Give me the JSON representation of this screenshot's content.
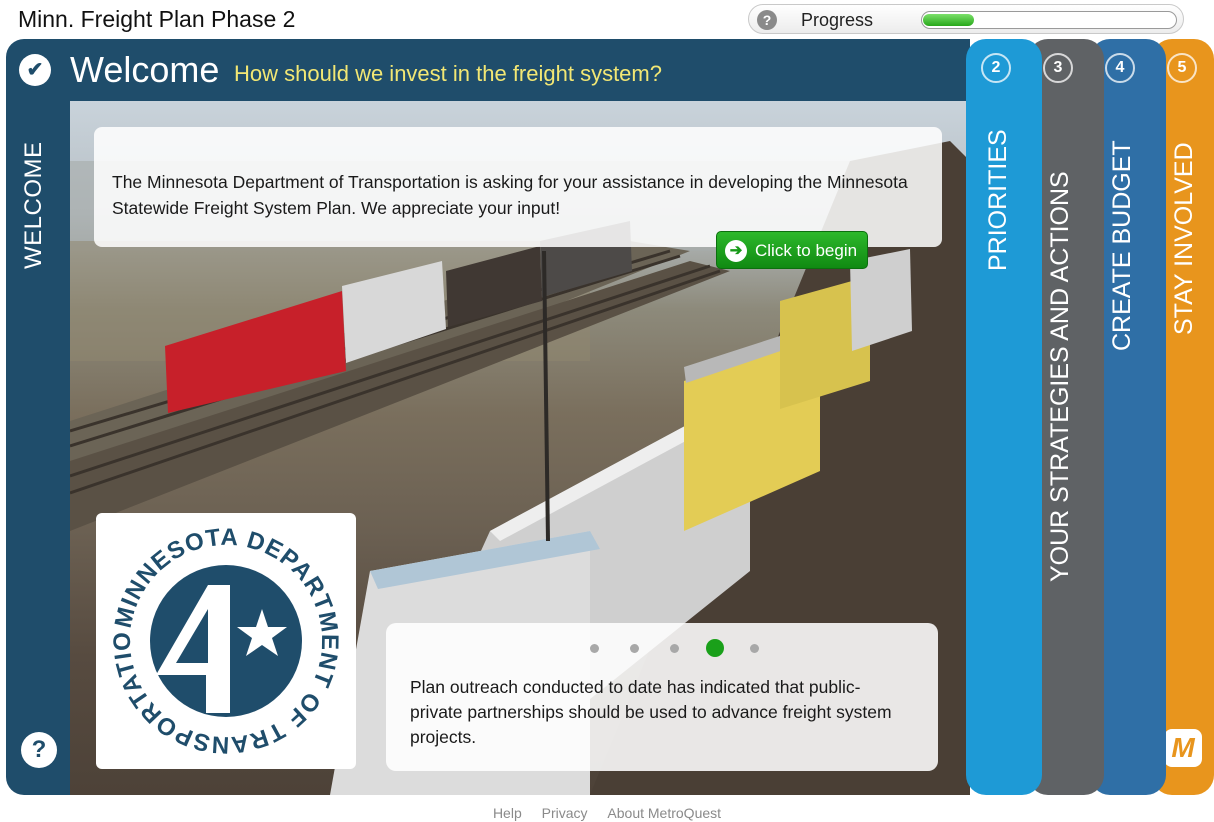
{
  "app": {
    "title": "Minn. Freight Plan Phase 2"
  },
  "progress": {
    "help": "?",
    "label": "Progress",
    "fraction": 0.2
  },
  "rail": {
    "check": "✔",
    "label": "WELCOME",
    "help": "?"
  },
  "header": {
    "title": "Welcome",
    "subtitle": "How should we invest in the freight system?"
  },
  "intro": {
    "text": "The Minnesota Department of Transportation is asking for your assistance in developing the Minnesota Statewide Freight System Plan. We appreciate your input!",
    "button_label": "Click to begin",
    "button_icon": "arrow-right-icon"
  },
  "logo": {
    "text": "MINNESOTA DEPARTMENT OF TRANSPORTATION"
  },
  "slides": {
    "count": 5,
    "active_index": 3,
    "text": "Plan outreach conducted to date has indicated that public-private partnerships should be used to advance freight system projects."
  },
  "tabs": [
    {
      "number": "2",
      "label": "PRIORITIES",
      "color": "#1e9ad6"
    },
    {
      "number": "3",
      "label": "YOUR STRATEGIES AND ACTIONS",
      "color": "#5f6265"
    },
    {
      "number": "4",
      "label": "CREATE BUDGET",
      "color": "#2f6fa6"
    },
    {
      "number": "5",
      "label": "STAY INVOLVED",
      "color": "#e8951d"
    }
  ],
  "brand": {
    "metroquest_mark": "M"
  },
  "footer": {
    "help": "Help",
    "privacy": "Privacy",
    "about": "About MetroQuest"
  },
  "colors": {
    "navy": "#1f4d6b",
    "accent_yellow": "#f2e774",
    "green": "#1aa01a"
  }
}
